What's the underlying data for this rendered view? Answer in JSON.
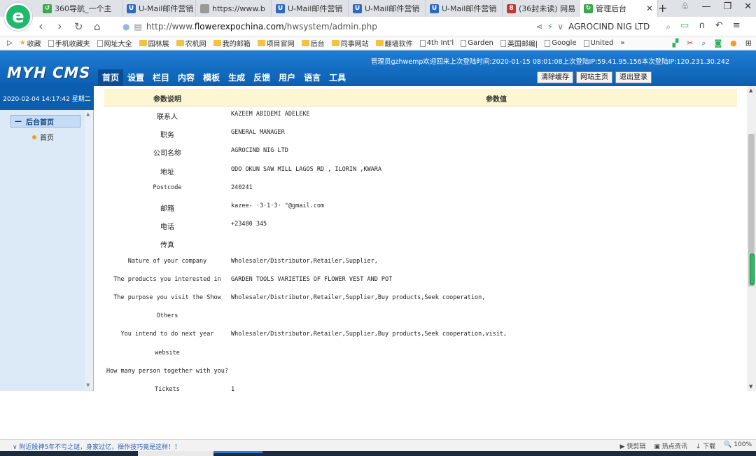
{
  "browser": {
    "tabs": [
      {
        "title": "360导航_一个主",
        "icon_color": "#3aa94b",
        "icon_glyph": "↺"
      },
      {
        "title": "U-Mail邮件营销",
        "icon_color": "#2b6bc7",
        "icon_glyph": "U"
      },
      {
        "title": "https://www.b",
        "icon_color": "#999999",
        "icon_glyph": ""
      },
      {
        "title": "U-Mail邮件营销",
        "icon_color": "#2b6bc7",
        "icon_glyph": "U"
      },
      {
        "title": "U-Mail邮件营销",
        "icon_color": "#2b6bc7",
        "icon_glyph": "U"
      },
      {
        "title": "U-Mail邮件营销",
        "icon_color": "#2b6bc7",
        "icon_glyph": "U"
      },
      {
        "title": "(36封未读) 网易",
        "icon_color": "#d1322c",
        "icon_glyph": "8"
      },
      {
        "title": "管理后台",
        "icon_color": "#3aa94b",
        "icon_glyph": "↻"
      }
    ],
    "url_prefix": "http://www.",
    "url_domain": "flowerexpochina.com",
    "url_path": "/hwsystem/admin.php",
    "search_text": "AGROCIND NIG LTD",
    "bookmarks": [
      {
        "label": "收藏",
        "kind": "star"
      },
      {
        "label": "手机收藏夹",
        "kind": "page"
      },
      {
        "label": "网址大全",
        "kind": "page"
      },
      {
        "label": "园林展",
        "kind": "folder"
      },
      {
        "label": "农机网",
        "kind": "folder"
      },
      {
        "label": "我的邮箱",
        "kind": "folder"
      },
      {
        "label": "项目官网",
        "kind": "folder"
      },
      {
        "label": "后台",
        "kind": "folder"
      },
      {
        "label": "同事网站",
        "kind": "folder"
      },
      {
        "label": "翻墙软件",
        "kind": "folder"
      },
      {
        "label": "4th Int'l",
        "kind": "page"
      },
      {
        "label": "Garden",
        "kind": "page"
      },
      {
        "label": "英国邮编|",
        "kind": "page"
      },
      {
        "label": "Google",
        "kind": "page"
      },
      {
        "label": "United",
        "kind": "page"
      },
      {
        "label": "»",
        "kind": "none"
      }
    ]
  },
  "cms": {
    "logo": "MYH CMS",
    "admin_info": "管理员gzhwemp欢迎回来上次登陆时间:2020-01-15 08:01:08上次登陆IP:59.41.95.156本次登陆IP:120.231.30.242",
    "nav": [
      "首页",
      "设置",
      "栏目",
      "内容",
      "模板",
      "生成",
      "反馈",
      "用户",
      "语言",
      "工具"
    ],
    "actions": [
      "清除缓存",
      "网站主页",
      "退出登录"
    ],
    "date": "2020-02-04 14:17:42 星期二",
    "side_group": "后台首页",
    "side_group_prefix": "—",
    "side_item": "首页"
  },
  "table": {
    "header_label": "参数说明",
    "header_value": "参数值",
    "rows": [
      {
        "label": "联系人",
        "value": "KAZEEM ABIDEMI ADELEKE"
      },
      {
        "label": "职务",
        "value": "GENERAL MANAGER"
      },
      {
        "label": "公司名称",
        "value": "AGROCIND NIG LTD"
      },
      {
        "label": "地址",
        "value": "ODO OKUN SAW MILL LAGOS RD , ILORIN ,KWARA"
      },
      {
        "label": "Postcode",
        "value": "240241"
      },
      {
        "label": "邮箱",
        "value": "kazee-  ·3·1·3·  °@gmail.com"
      },
      {
        "label": "电话",
        "value": "+23480      345"
      },
      {
        "label": "传真",
        "value": ""
      },
      {
        "label": "Nature of your company",
        "value": "Wholesaler/Distributor,Retailer,Supplier,"
      },
      {
        "label": "The products you interested in",
        "value": "GARDEN TOOLS VARIETIES OF FLOWER VEST AND POT"
      },
      {
        "label": "The purpose you visit the Show",
        "value": "Wholesaler/Distributor,Retailer,Supplier,Buy products,Seek cooperation,"
      },
      {
        "label": "Others",
        "value": ""
      },
      {
        "label": "You intend to do next year",
        "value": "Wholesaler/Distributor,Retailer,Supplier,Buy products,Seek cooperation,visit,"
      },
      {
        "label": "website",
        "value": ""
      },
      {
        "label": "How many person together with you?",
        "value": ""
      },
      {
        "label": "Tickets",
        "value": "1"
      }
    ]
  },
  "status": {
    "news": "附近股神5年不亏之谜，身家过亿，操作技巧竟是这样！！",
    "tools": [
      "快剪辑",
      "热点资讯",
      "下载",
      "100%"
    ]
  }
}
